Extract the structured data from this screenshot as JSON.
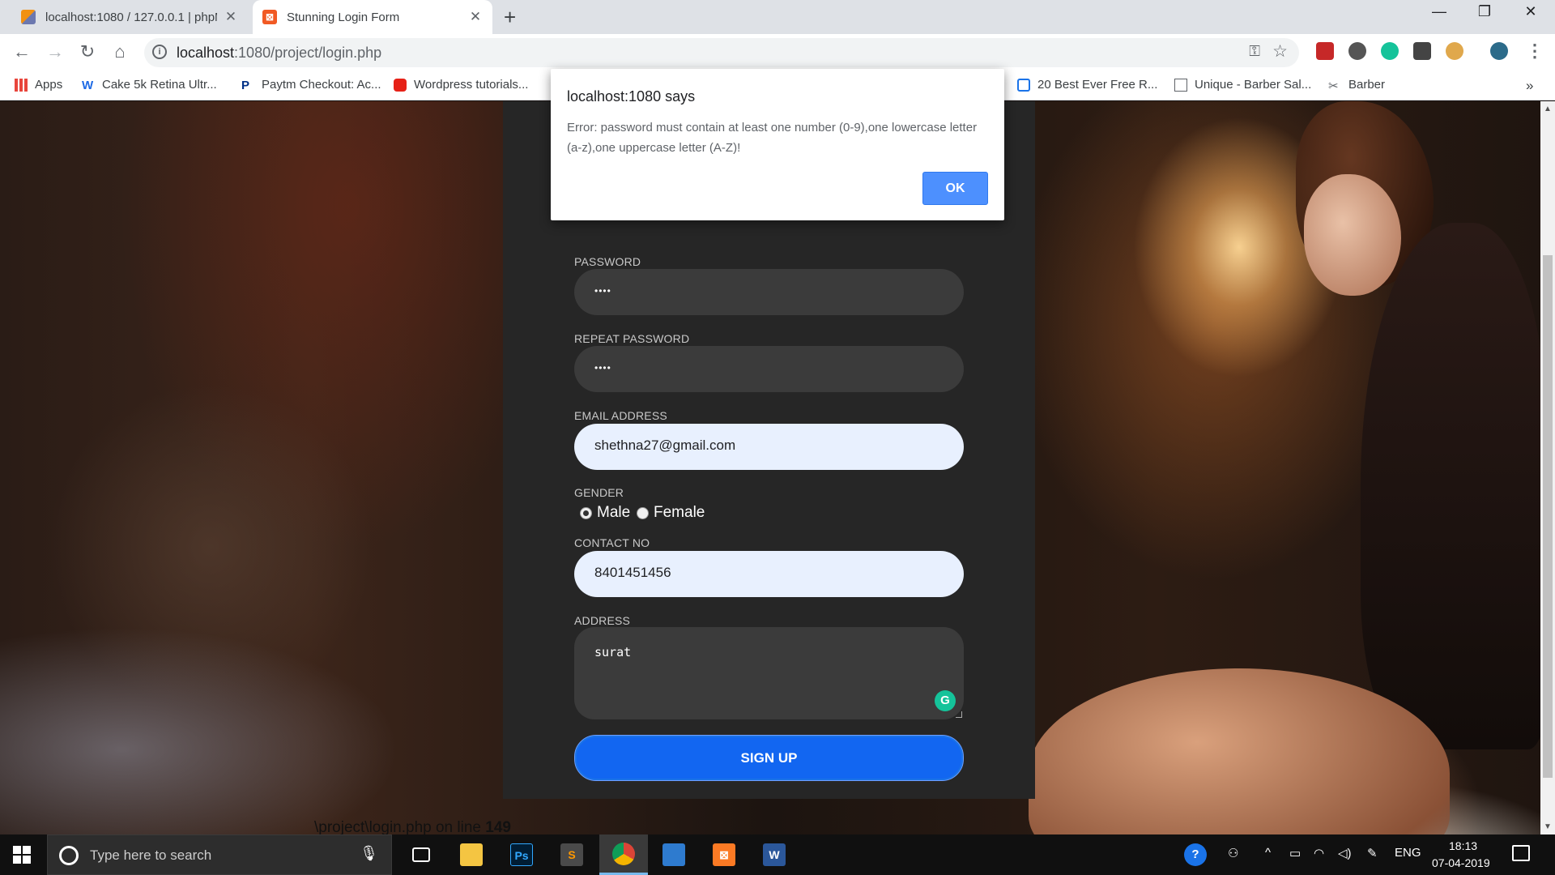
{
  "browser": {
    "tabs": [
      {
        "title": "localhost:1080 / 127.0.0.1 | phpM",
        "active": false
      },
      {
        "title": "Stunning Login Form",
        "active": true
      }
    ],
    "url_host": "localhost",
    "url_path": ":1080/project/login.php",
    "bookmarks": [
      {
        "label": "Apps",
        "icon": "apps-grid-icon"
      },
      {
        "label": "Cake 5k Retina Ultr...",
        "icon": "wix-icon"
      },
      {
        "label": "Paytm Checkout: Ac...",
        "icon": "paypal-icon"
      },
      {
        "label": "Wordpress tutorials...",
        "icon": "youtube-icon"
      },
      {
        "label": "20 Best Ever Free R...",
        "icon": "bookmark-page-icon"
      },
      {
        "label": "Unique - Barber Sal...",
        "icon": "document-icon"
      },
      {
        "label": "Barber",
        "icon": "barber-icon"
      }
    ]
  },
  "alert": {
    "title": "localhost:1080 says",
    "message": "Error: password must contain at least one number (0-9),one lowercase letter (a-z),one uppercase letter (A-Z)!",
    "ok_label": "OK"
  },
  "form": {
    "password_label": "PASSWORD",
    "password_mask": "••••",
    "repeat_password_label": "REPEAT PASSWORD",
    "repeat_password_mask": "••••",
    "email_label": "EMAIL ADDRESS",
    "email_value": "shethna27@gmail.com",
    "gender_label": "GENDER",
    "gender_options": [
      "Male",
      "Female"
    ],
    "gender_selected": "Male",
    "contact_label": "CONTACT NO",
    "contact_value": "8401451456",
    "address_label": "ADDRESS",
    "address_value": "surat",
    "submit_label": "SIGN UP"
  },
  "page": {
    "php_warning_path": "\\project\\login.php on line ",
    "php_warning_line": "149"
  },
  "taskbar": {
    "search_placeholder": "Type here to search",
    "apps": [
      "file-explorer-icon",
      "photoshop-icon",
      "sublime-text-icon",
      "chrome-icon",
      "virtualbox-icon",
      "xampp-icon",
      "word-icon"
    ],
    "language": "ENG",
    "time": "18:13",
    "date": "07-04-2019"
  },
  "colors": {
    "primary_button": "#1266f1",
    "form_panel": "#262626",
    "autofill_field": "#e8f0fe",
    "dialog_ok": "#4d90fe"
  }
}
